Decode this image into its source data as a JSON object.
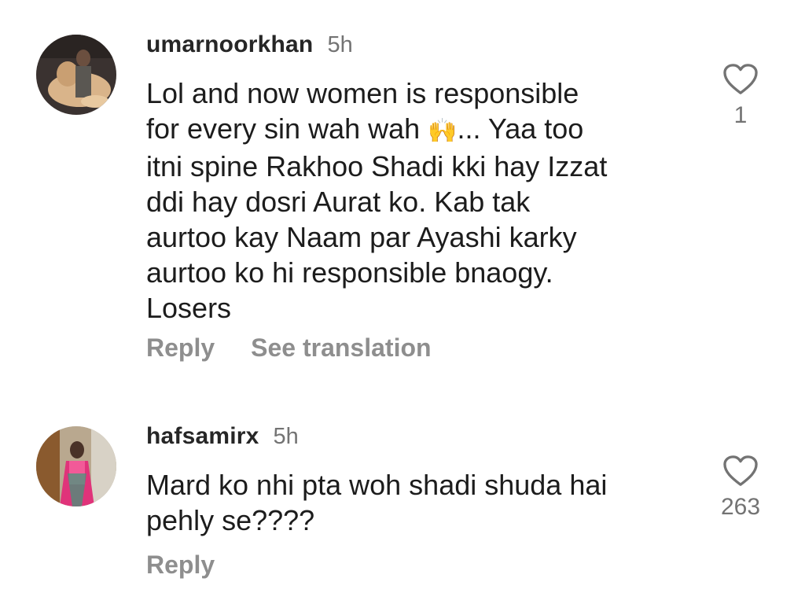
{
  "comments": [
    {
      "username": "umarnoorkhan",
      "time": "5h",
      "text_lines": [
        "Lol and now women is responsible",
        "for every sin wah wah",
        "... Yaa too",
        "itni spine Rakhoo Shadi kki hay Izzat",
        "ddi hay dosri Aurat ko. Kab tak",
        "aurtoo kay Naam par Ayashi karky",
        "aurtoo ko hi responsible bnaogy.",
        "Losers"
      ],
      "emoji_icon": "raising-hands-emoji",
      "emoji_glyph": "🙌",
      "reply_label": "Reply",
      "translate_label": "See translation",
      "like_icon": "heart-icon",
      "likes": "1"
    },
    {
      "username": "hafsamirx",
      "time": "5h",
      "text_lines": [
        "Mard ko nhi pta woh shadi shuda hai",
        "pehly se????"
      ],
      "reply_label": "Reply",
      "like_icon": "heart-icon",
      "likes": "263"
    }
  ],
  "colors": {
    "username": "#262626",
    "secondary": "#737373",
    "action": "#8e8e8e",
    "text": "#1c1c1c"
  }
}
